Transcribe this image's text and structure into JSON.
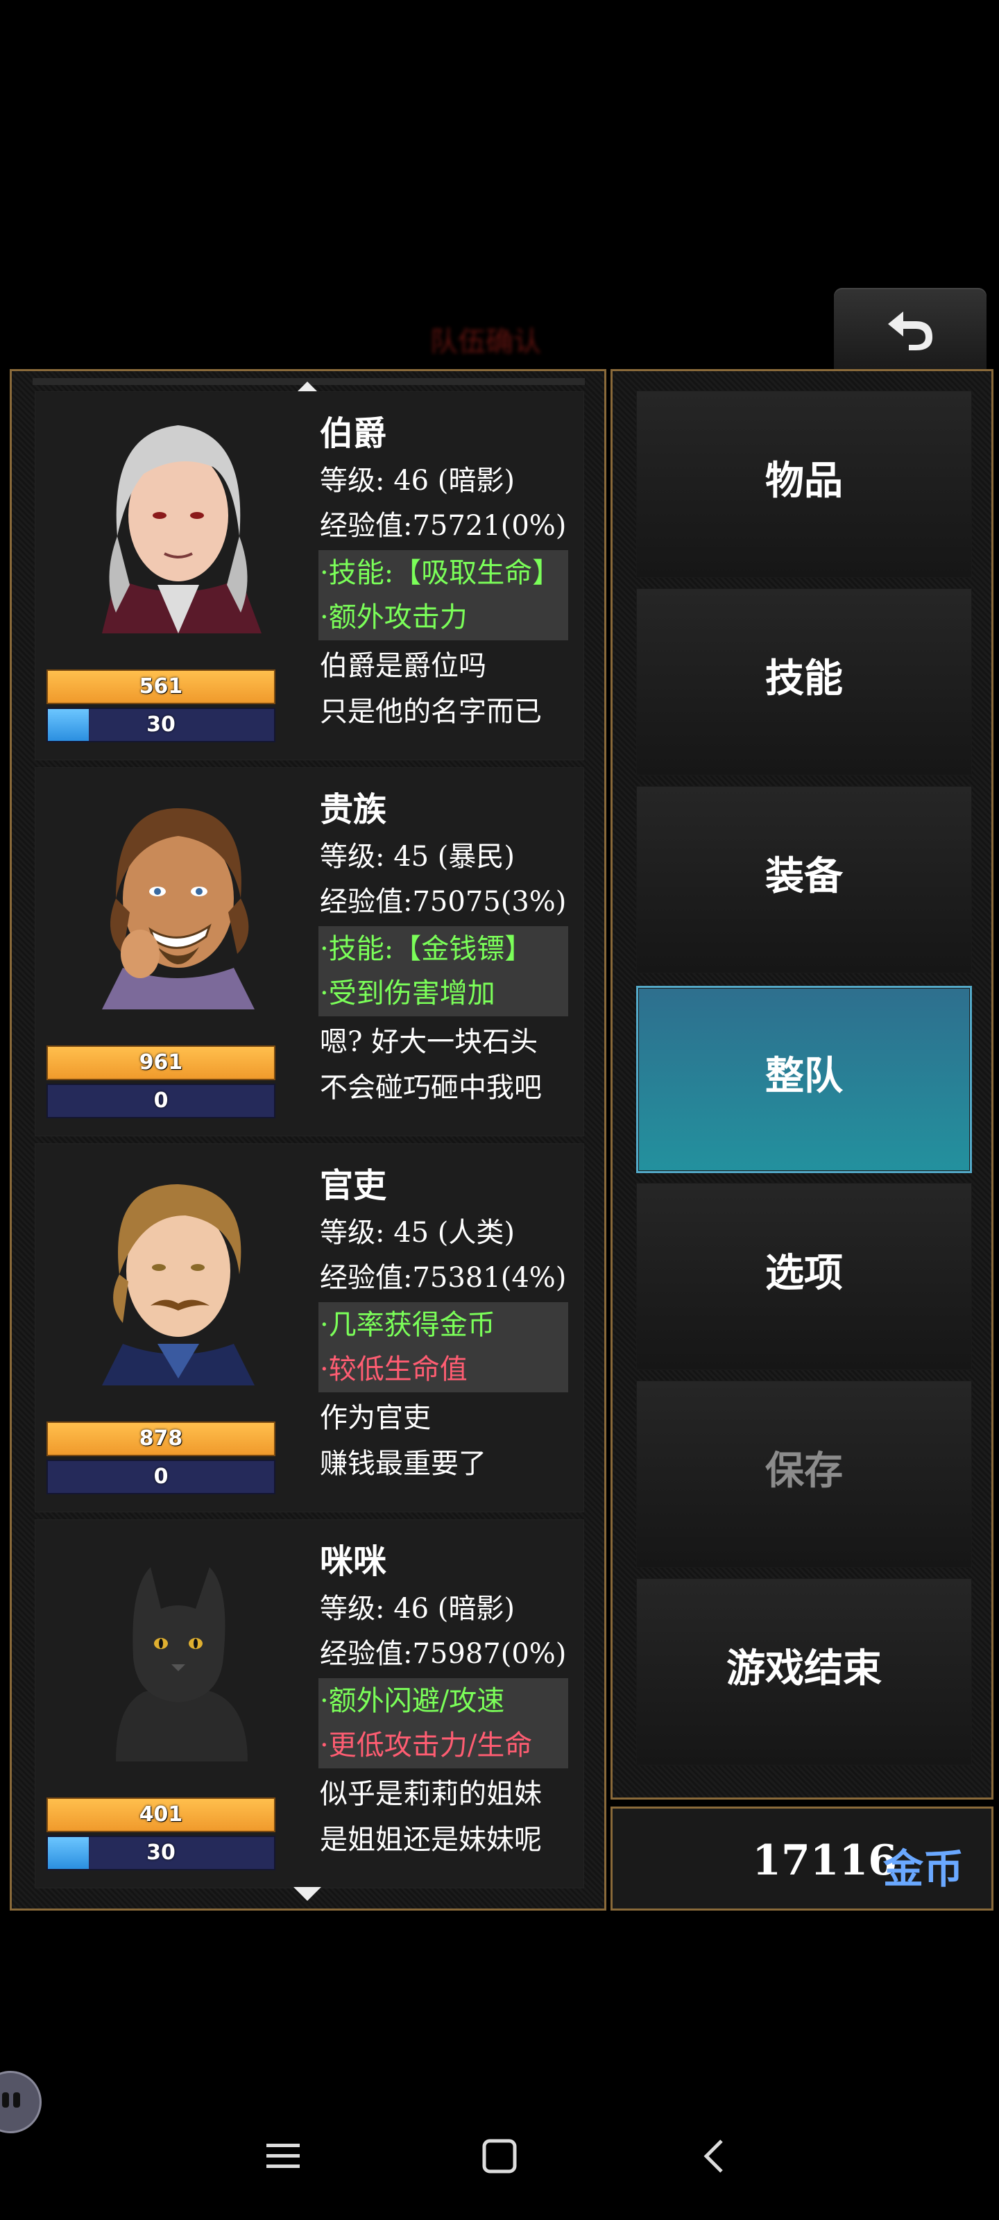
{
  "screen_title": "队伍确认",
  "characters": [
    {
      "name": "伯爵",
      "level_label": "等级: 46 (暗影)",
      "exp_label": "经验值:75721(0%)",
      "trait1": "·技能:【吸取生命】",
      "trait1_color": "green",
      "trait2": "·额外攻击力",
      "trait2_color": "green",
      "desc1": "伯爵是爵位吗",
      "desc2": "只是他的名字而已",
      "hp": "561",
      "mp": "30"
    },
    {
      "name": "贵族",
      "level_label": "等级: 45 (暴民)",
      "exp_label": "经验值:75075(3%)",
      "trait1": "·技能:【金钱镖】",
      "trait1_color": "green",
      "trait2": "·受到伤害增加",
      "trait2_color": "green",
      "desc1": "嗯? 好大一块石头",
      "desc2": "不会碰巧砸中我吧",
      "hp": "961",
      "mp": "0"
    },
    {
      "name": "官吏",
      "level_label": "等级: 45 (人类)",
      "exp_label": "经验值:75381(4%)",
      "trait1": "·几率获得金币",
      "trait1_color": "green",
      "trait2": "·较低生命值",
      "trait2_color": "red",
      "desc1": "作为官吏",
      "desc2": "赚钱最重要了",
      "hp": "878",
      "mp": "0"
    },
    {
      "name": "咪咪",
      "level_label": "等级: 46 (暗影)",
      "exp_label": "经验值:75987(0%)",
      "trait1": "·额外闪避/攻速",
      "trait1_color": "green",
      "trait2": "·更低攻击力/生命",
      "trait2_color": "red",
      "desc1": "似乎是莉莉的姐妹",
      "desc2": "是姐姐还是妹妹呢",
      "hp": "401",
      "mp": "30"
    }
  ],
  "menu": {
    "items": "物品",
    "skills": "技能",
    "equipment": "装备",
    "party": "整队",
    "options": "选项",
    "save": "保存",
    "game_over": "游戏结束",
    "active": "整队"
  },
  "gold": {
    "amount": "17116",
    "unit": "金币"
  },
  "icons": {
    "back": "back-arrow-icon",
    "scroll_up": "scroll-up-arrow-icon",
    "scroll_down": "scroll-down-arrow-icon",
    "nav_menu": "menu-lines-icon",
    "nav_home": "home-square-icon",
    "nav_back": "chevron-left-icon",
    "floating": "chat-bubble-icon"
  },
  "colors": {
    "accent_active": "#2a8a9c",
    "gold_unit": "#6aa8ff",
    "positive_trait": "#7bff59",
    "negative_trait": "#ff5d72",
    "hp_bar": "#f5ad3c",
    "mp_bar": "#3a9bea",
    "frame": "#8a6a3a"
  }
}
